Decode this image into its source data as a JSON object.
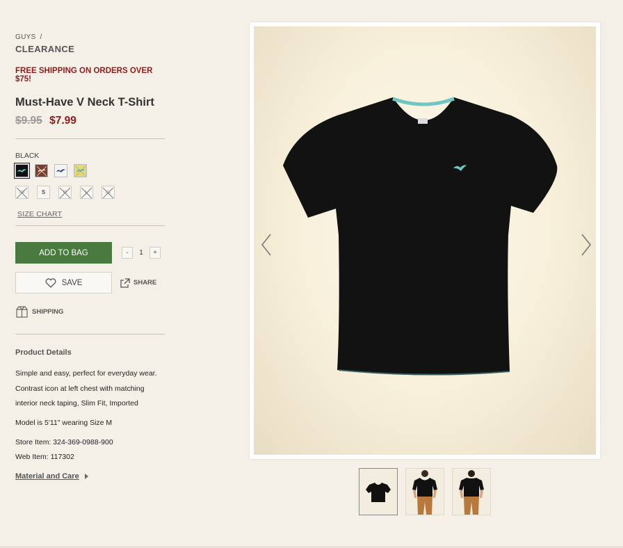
{
  "breadcrumb": {
    "parent": "GUYS",
    "separator": "/",
    "current": "CLEARANCE"
  },
  "promo": "FREE SHIPPING ON ORDERS OVER $75!",
  "product": {
    "title": "Must-Have V Neck T-Shirt",
    "old_price": "$9.95",
    "price": "$7.99",
    "color_label": "BLACK",
    "colors": [
      {
        "name": "black",
        "color": "#111111",
        "selected": true
      },
      {
        "name": "burgundy",
        "color": "#7a3b33",
        "selected": false
      },
      {
        "name": "white",
        "color": "#f4f4f4",
        "selected": false
      },
      {
        "name": "yellow",
        "color": "#e8d870",
        "selected": false
      }
    ],
    "sizes": [
      {
        "label": "XS",
        "available": false
      },
      {
        "label": "S",
        "available": true
      },
      {
        "label": "M",
        "available": false
      },
      {
        "label": "L",
        "available": false
      },
      {
        "label": "XL",
        "available": false
      }
    ],
    "size_chart": "SIZE CHART",
    "add_to_bag": "ADD TO BAG",
    "qty": {
      "minus": "-",
      "value": "1",
      "plus": "+"
    },
    "save": "SAVE",
    "share": "SHARE",
    "shipping": "SHIPPING",
    "details_title": "Product Details",
    "description_lines": [
      "Simple and easy, perfect for everyday wear.",
      "Contrast icon at left chest with matching",
      "interior neck taping, Slim Fit, Imported"
    ],
    "model_info": "Model is 5'11\" wearing Size M",
    "store_item": "Store Item: 324-369-0988-900",
    "web_item": "Web Item: 117302",
    "material_care": "Material and Care"
  },
  "gallery": {
    "icons": [
      "chevron-left-icon",
      "chevron-right-icon"
    ],
    "thumbnails": [
      "flat-tshirt",
      "model-front",
      "model-back"
    ],
    "selected_thumbnail": 0
  }
}
